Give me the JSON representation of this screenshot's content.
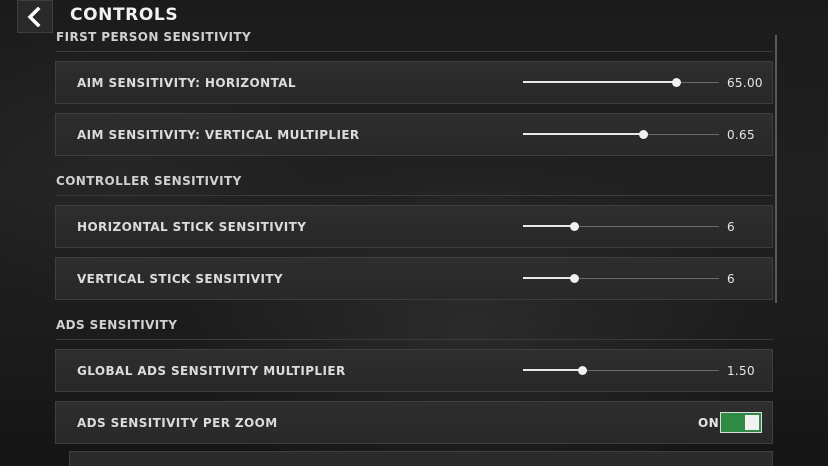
{
  "header": {
    "title": "CONTROLS",
    "back_icon": "chevron-left-icon"
  },
  "sections": [
    {
      "heading": "FIRST PERSON SENSITIVITY",
      "rows": [
        {
          "label": "AIM SENSITIVITY: HORIZONTAL",
          "value": "65.00",
          "fraction": 0.78
        },
        {
          "label": "AIM SENSITIVITY: VERTICAL MULTIPLIER",
          "value": "0.65",
          "fraction": 0.61
        }
      ]
    },
    {
      "heading": "CONTROLLER SENSITIVITY",
      "rows": [
        {
          "label": "HORIZONTAL STICK SENSITIVITY",
          "value": "6",
          "fraction": 0.26
        },
        {
          "label": "VERTICAL STICK SENSITIVITY",
          "value": "6",
          "fraction": 0.26
        }
      ]
    },
    {
      "heading": "ADS SENSITIVITY",
      "rows": [
        {
          "label": "GLOBAL ADS SENSITIVITY MULTIPLIER",
          "value": "1.50",
          "fraction": 0.3
        },
        {
          "label": "ADS SENSITIVITY PER ZOOM",
          "toggle_state": "ON",
          "toggle_on": true
        }
      ]
    }
  ],
  "colors": {
    "toggle_on": "#2f8a45",
    "background": "#1b1b1b",
    "row": "#2b2b2b"
  }
}
